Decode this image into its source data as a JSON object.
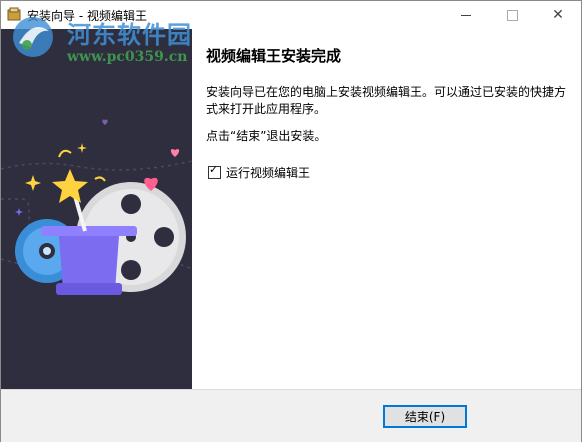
{
  "window": {
    "title": "安装向导 - 视频编辑王",
    "min_icon": "minimize-icon",
    "max_icon": "maximize-icon",
    "close_icon": "close-icon"
  },
  "watermark": {
    "name": "河东软件园",
    "url": "www.pc0359.cn"
  },
  "content": {
    "heading": "视频编辑王安装完成",
    "paragraph1": "安装向导已在您的电脑上安装视频编辑王。可以通过已安装的快捷方式来打开此应用程序。",
    "paragraph2": "点击“结束”退出安装。",
    "checkbox_label": "运行视频编辑王",
    "checkbox_checked": true
  },
  "footer": {
    "finish_label": "结束(F)"
  },
  "colors": {
    "side_panel_bg": "#2e2e3e",
    "accent": "#0078d7",
    "hat": "#7b6cf0",
    "star": "#ffd23f",
    "heart": "#ff5f8f"
  }
}
